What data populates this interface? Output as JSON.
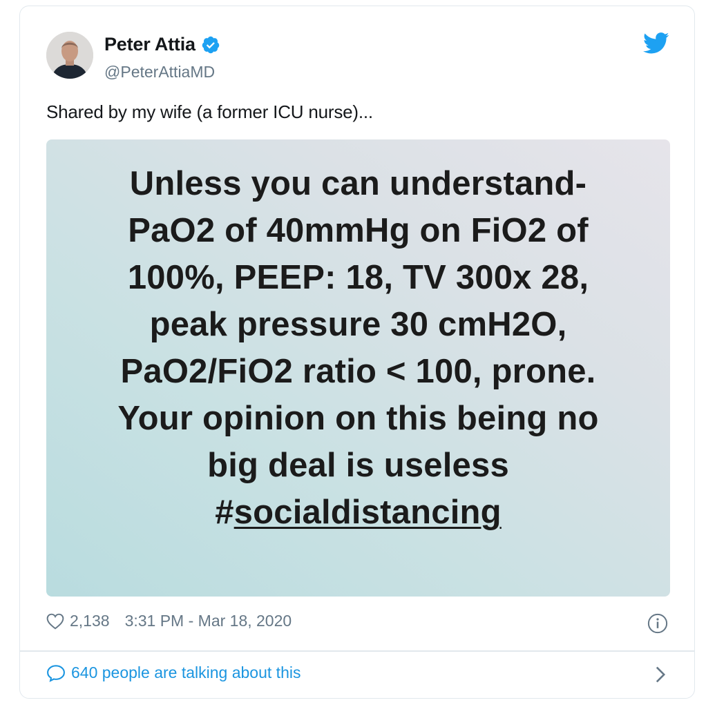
{
  "author": {
    "name": "Peter Attia",
    "handle": "@PeterAttiaMD",
    "verified": true,
    "avatar_icon": "profile-photo"
  },
  "tweet": {
    "text": "Shared by my wife (a former ICU nurse)...",
    "media": {
      "lines": [
        "Unless you can understand-",
        "PaO2 of 40mmHg on FiO2 of",
        "100%, PEEP: 18, TV 300x 28,",
        "peak pressure 30 cmH2O,",
        "PaO2/FiO2 ratio < 100, prone.",
        "Your opinion on this being no",
        "big deal is useless"
      ],
      "hashtag_prefix": "#",
      "hashtag_word": "socialdistancing"
    }
  },
  "meta": {
    "likes": "2,138",
    "timestamp": "3:31 PM - Mar 18, 2020"
  },
  "conversation": {
    "label": "640 people are talking about this"
  },
  "colors": {
    "brand_blue": "#1da1f2",
    "link_blue": "#1b95e0",
    "secondary_text": "#657786",
    "border": "#e1e8ed"
  }
}
